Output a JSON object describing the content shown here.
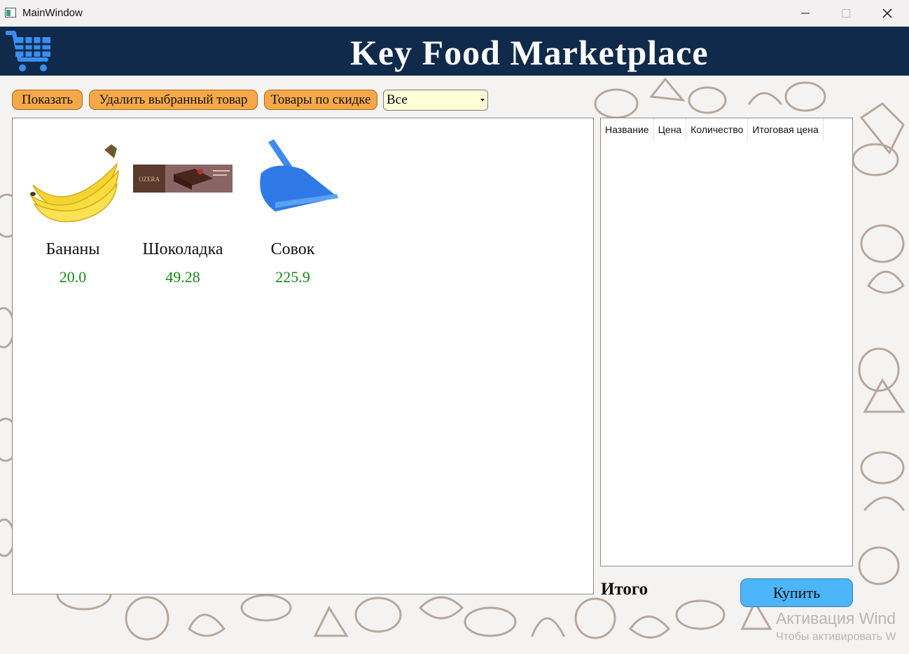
{
  "window": {
    "title": "MainWindow",
    "controls": [
      "minimize",
      "maximize",
      "close"
    ]
  },
  "header": {
    "brand": "Key Food Marketplace",
    "logo_icon": "shopping-cart-icon",
    "colors": {
      "background": "#102a4b",
      "logo": "#3a8ef0",
      "text": "#ffffff"
    }
  },
  "toolbar": {
    "show_label": "Показать",
    "delete_label": "Удалить выбранный товар",
    "discount_label": "Товары по скидке",
    "filter": {
      "selected": "Все"
    },
    "colors": {
      "button": "#f5a847",
      "select": "#fcffd6"
    }
  },
  "products": [
    {
      "name": "Бананы",
      "price": "20.0",
      "image": "banana"
    },
    {
      "name": "Шоколадка",
      "price": "49.28",
      "image": "chocolate-bar"
    },
    {
      "name": "Совок",
      "price": "225.9",
      "image": "dustpan"
    }
  ],
  "cart": {
    "columns": [
      "Название",
      "Цена",
      "Количество",
      "Итоговая цена"
    ],
    "rows": []
  },
  "footer": {
    "total_label": "Итого",
    "buy_label": "Купить",
    "buy_color": "#4db5f9"
  },
  "watermark": {
    "line1": "Активация Wind",
    "line2": "Чтобы активировать W"
  },
  "colors": {
    "price": "#138a13"
  }
}
